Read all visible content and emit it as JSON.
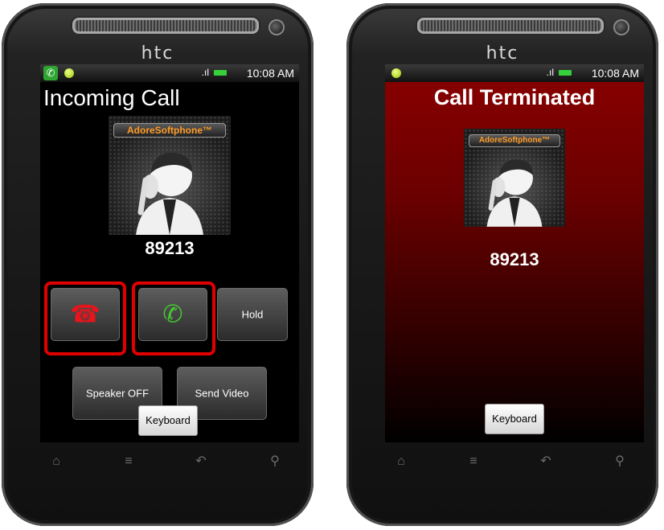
{
  "left_phone": {
    "brand": "htc",
    "status": {
      "time": "10:08 AM",
      "signal_glyph": ".ıl"
    },
    "title": "Incoming Call",
    "avatar_brand": "AdoreSoftphone™",
    "number": "89213",
    "buttons": {
      "hangup_icon": "☎",
      "answer_icon": "✆",
      "hold": "Hold",
      "speaker": "Speaker OFF",
      "send_video": "Send Video",
      "keyboard": "Keyboard"
    },
    "highlight_color": "#e00000"
  },
  "right_phone": {
    "brand": "htc",
    "status": {
      "time": "10:08 AM",
      "signal_glyph": ".ıl"
    },
    "title": "Call Terminated",
    "avatar_brand": "AdoreSoftphone™",
    "number": "89213",
    "keyboard": "Keyboard",
    "background_color": "#7a0000"
  },
  "nav_icons": [
    "home-icon",
    "menu-icon",
    "back-icon",
    "search-icon"
  ],
  "colors": {
    "hangup": "#e8141c",
    "answer": "#46c832",
    "battery": "#35d03a"
  }
}
